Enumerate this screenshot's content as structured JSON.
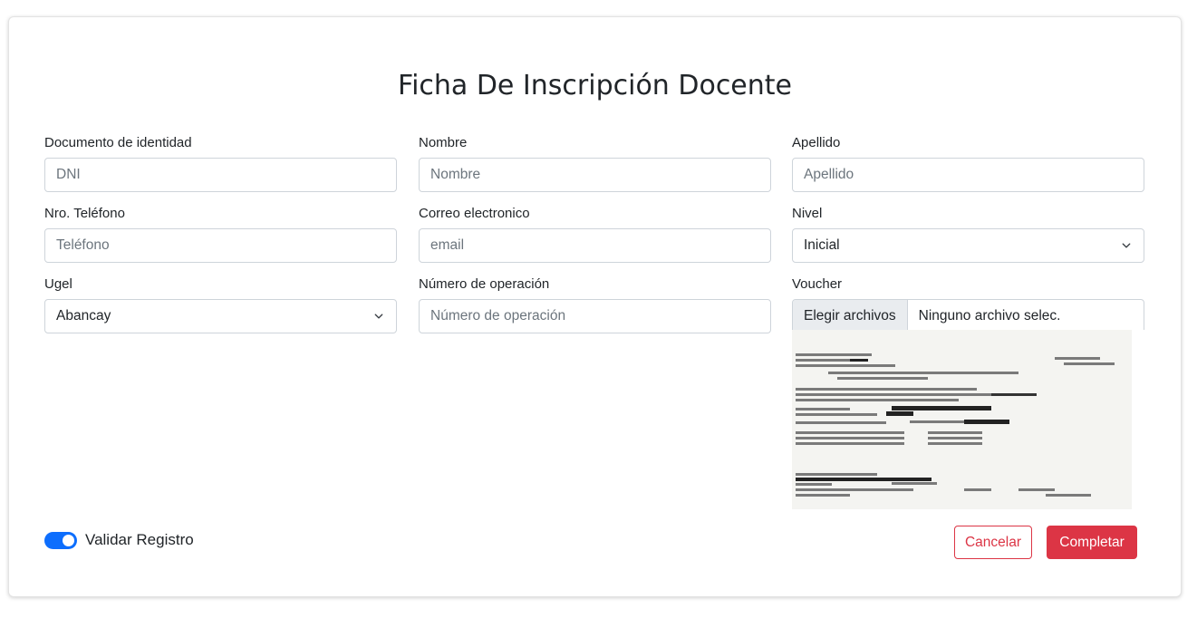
{
  "form": {
    "title": "Ficha De Inscripción Docente",
    "fields": {
      "dni": {
        "label": "Documento de identidad",
        "placeholder": "DNI",
        "value": ""
      },
      "nombre": {
        "label": "Nombre",
        "placeholder": "Nombre",
        "value": ""
      },
      "apellido": {
        "label": "Apellido",
        "placeholder": "Apellido",
        "value": ""
      },
      "telefono": {
        "label": "Nro. Teléfono",
        "placeholder": "Teléfono",
        "value": ""
      },
      "correo": {
        "label": "Correo electronico",
        "placeholder": "email",
        "value": ""
      },
      "nivel": {
        "label": "Nivel",
        "selected": "Inicial"
      },
      "ugel": {
        "label": "Ugel",
        "selected": "Abancay"
      },
      "operacion": {
        "label": "Número de operación",
        "placeholder": "Número de operación",
        "value": ""
      },
      "voucher": {
        "label": "Voucher",
        "button": "Elegir archivos",
        "filename": "Ninguno archivo selec."
      }
    },
    "toggle": {
      "label": "Validar Registro",
      "checked": true
    },
    "buttons": {
      "cancel": "Cancelar",
      "complete": "Completar"
    }
  },
  "colors": {
    "primary": "#0d6efd",
    "danger": "#dc3545",
    "border": "#ced4da"
  },
  "icons": {
    "select_arrow": "chevron-down-icon",
    "toggle": "toggle-switch-icon"
  }
}
